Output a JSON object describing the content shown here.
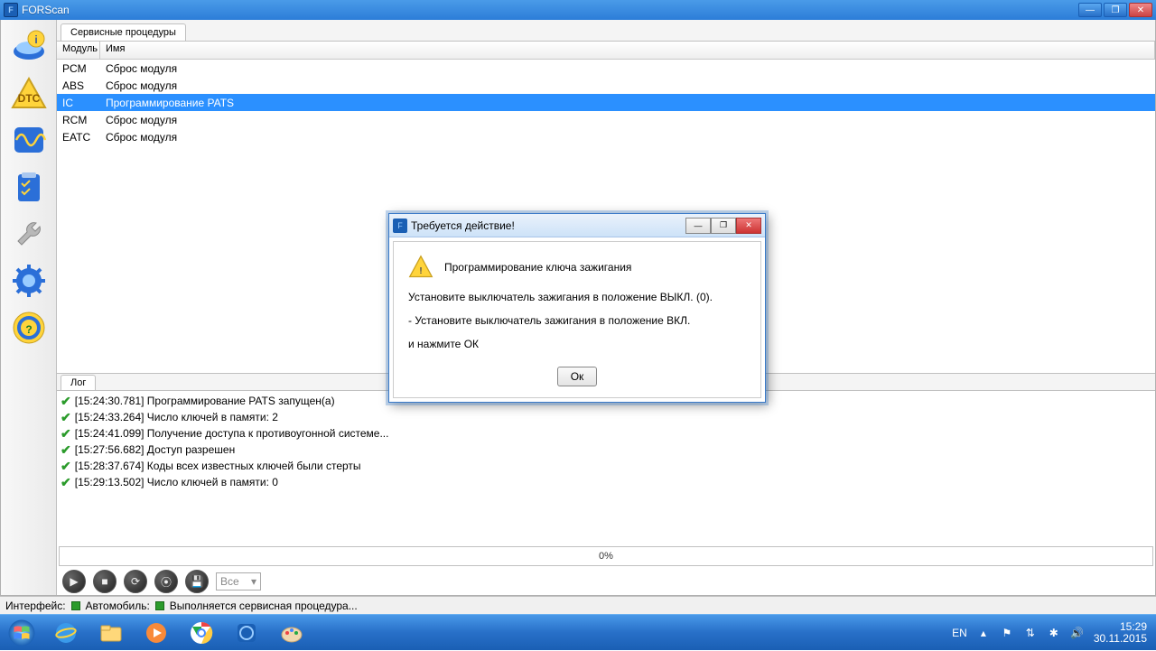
{
  "window": {
    "title": "FORScan"
  },
  "tabs": {
    "service": "Сервисные процедуры"
  },
  "table": {
    "headers": {
      "module": "Модуль",
      "name": "Имя"
    },
    "rows": [
      {
        "module": "PCM",
        "name": "Сброс модуля",
        "selected": false
      },
      {
        "module": "ABS",
        "name": "Сброс модуля",
        "selected": false
      },
      {
        "module": "IC",
        "name": "Программирование PATS",
        "selected": true
      },
      {
        "module": "RCM",
        "name": "Сброс модуля",
        "selected": false
      },
      {
        "module": "EATC",
        "name": "Сброс модуля",
        "selected": false
      }
    ]
  },
  "log": {
    "tab": "Лог",
    "lines": [
      "[15:24:30.781] Программирование PATS запущен(а)",
      "[15:24:33.264] Число ключей в памяти: 2",
      "[15:24:41.099] Получение доступа к противоугонной системе...",
      "[15:27:56.682] Доступ разрешен",
      "[15:28:37.674] Коды всех известных ключей были стерты",
      "[15:29:13.502] Число ключей в памяти: 0"
    ]
  },
  "progress": {
    "text": "0%"
  },
  "combo": {
    "value": "Все"
  },
  "status": {
    "interface": "Интерфейс:",
    "vehicle": "Автомобиль:",
    "operation": "Выполняется сервисная процедура..."
  },
  "dialog": {
    "title": "Требуется действие!",
    "heading": "Программирование ключа зажигания",
    "line1": "Установите выключатель зажигания в положение ВЫКЛ. (0).",
    "line2": "- Установите выключатель зажигания в положение ВКЛ.",
    "line3": "и нажмите ОК",
    "ok": "Ок"
  },
  "tray": {
    "lang": "EN",
    "time": "15:29",
    "date": "30.11.2015"
  }
}
